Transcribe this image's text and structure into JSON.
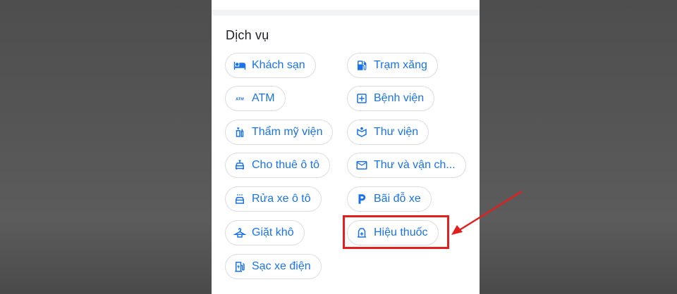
{
  "section": {
    "title": "Dịch vụ"
  },
  "services": [
    {
      "label": "Khách sạn",
      "icon": "hotel-bed-icon"
    },
    {
      "label": "Trạm xăng",
      "icon": "gas-station-icon"
    },
    {
      "label": "ATM",
      "icon": "atm-icon"
    },
    {
      "label": "Bệnh viện",
      "icon": "hospital-cross-icon"
    },
    {
      "label": "Thẩm mỹ viện",
      "icon": "beauty-salon-icon"
    },
    {
      "label": "Thư viện",
      "icon": "library-icon"
    },
    {
      "label": "Cho thuê ô tô",
      "icon": "car-rental-icon"
    },
    {
      "label": "Thư và vận ch...",
      "icon": "mail-icon"
    },
    {
      "label": "Rửa xe ô tô",
      "icon": "car-wash-icon"
    },
    {
      "label": "Bãi đỗ xe",
      "icon": "parking-icon"
    },
    {
      "label": "Giặt khô",
      "icon": "dry-cleaning-icon"
    },
    {
      "label": "Hiệu thuốc",
      "icon": "pharmacy-icon"
    },
    {
      "label": "Sạc xe điện",
      "icon": "ev-charging-icon"
    }
  ],
  "annotation": {
    "highlight_color": "#e0201f",
    "highlighted_item": "Hiệu thuốc"
  },
  "colors": {
    "accent": "#1a73e8",
    "chip_border": "#dadce0"
  }
}
